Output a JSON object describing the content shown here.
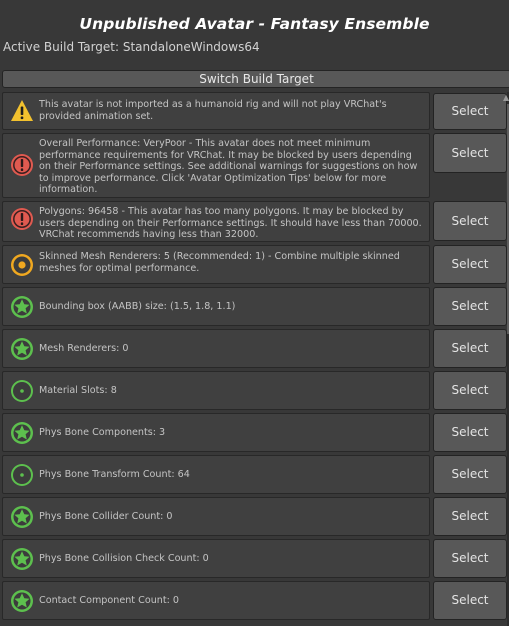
{
  "header": {
    "title": "Unpublished Avatar - Fantasy Ensemble",
    "build_target": "Active Build Target: StandaloneWindows64",
    "switch_button": "Switch Build Target"
  },
  "select_label": "Select",
  "rows": [
    {
      "icon": "warning-icon",
      "text": "This avatar is not imported as a humanoid rig and will not play VRChat's provided animation set."
    },
    {
      "icon": "error-icon",
      "text": "Overall Performance: VeryPoor - This avatar does not meet minimum performance requirements for VRChat. It may be blocked by users depending on their Performance settings. See additional warnings for suggestions on how to improve performance. Click 'Avatar Optimization Tips' below for more information."
    },
    {
      "icon": "error-icon",
      "text": "Polygons: 96458 - This avatar has too many polygons. It may be blocked by users depending on their Performance settings. It should have less than 70000. VRChat recommends having less than 32000."
    },
    {
      "icon": "medium-rating-icon",
      "text": "Skinned Mesh Renderers: 5 (Recommended: 1) - Combine multiple skinned meshes for optimal performance."
    },
    {
      "icon": "excellent-star-icon",
      "text": "Bounding box (AABB) size: (1.5, 1.8, 1.1)"
    },
    {
      "icon": "excellent-star-icon",
      "text": "Mesh Renderers: 0"
    },
    {
      "icon": "good-dot-icon",
      "text": "Material Slots: 8"
    },
    {
      "icon": "excellent-star-icon",
      "text": "Phys Bone Components: 3"
    },
    {
      "icon": "good-dot-icon",
      "text": "Phys Bone Transform Count: 64"
    },
    {
      "icon": "excellent-star-icon",
      "text": "Phys Bone Collider Count: 0"
    },
    {
      "icon": "excellent-star-icon",
      "text": "Phys Bone Collision Check Count: 0"
    },
    {
      "icon": "excellent-star-icon",
      "text": "Contact Component Count: 0"
    }
  ],
  "colors": {
    "warning": "#f2c12e",
    "error": "#e05a50",
    "medium": "#f0a820",
    "excellent": "#5dc04e",
    "good": "#5dc04e"
  }
}
